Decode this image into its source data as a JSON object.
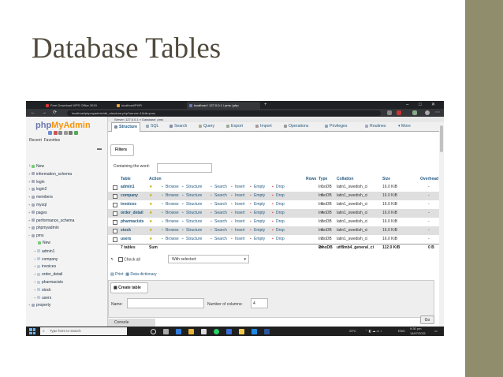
{
  "slide": {
    "title": "Database Tables",
    "accent_bar_color": "#8f8d6b"
  },
  "browser": {
    "tabs": [
      {
        "label": "Free Download WPS Office 2019",
        "favicon": "wps-icon",
        "active": false
      },
      {
        "label": "localhost/PHP/",
        "favicon": "folder-icon",
        "active": false
      },
      {
        "label": "localhost / 127.0.0.1 / pms | php",
        "favicon": "phpmyadmin-icon",
        "active": true
      }
    ],
    "new_tab": "+",
    "url": "localhost/phpmyadmin/db_structure.php?server=1&db=pms",
    "window_controls": [
      "–",
      "□",
      "✕"
    ]
  },
  "pma": {
    "logo_php": "php",
    "logo_myadmin": "MyAdmin",
    "recent": "Recent",
    "favorites": "Favorites",
    "tree": [
      {
        "label": "New",
        "level": 0
      },
      {
        "label": "information_schema",
        "level": 0
      },
      {
        "label": "login",
        "level": 0
      },
      {
        "label": "login2",
        "level": 0
      },
      {
        "label": "members",
        "level": 0
      },
      {
        "label": "mysql",
        "level": 0
      },
      {
        "label": "pages",
        "level": 0
      },
      {
        "label": "performance_schema",
        "level": 0
      },
      {
        "label": "phpmyadmin",
        "level": 0
      },
      {
        "label": "pms",
        "level": 0
      },
      {
        "label": "New",
        "level": 1
      },
      {
        "label": "admin1",
        "level": 1
      },
      {
        "label": "company",
        "level": 1
      },
      {
        "label": "invoices",
        "level": 1
      },
      {
        "label": "order_detail",
        "level": 1
      },
      {
        "label": "pharmacists",
        "level": 1
      },
      {
        "label": "stock",
        "level": 1
      },
      {
        "label": "users",
        "level": 1
      },
      {
        "label": "property",
        "level": 0
      }
    ],
    "breadcrumb": "Server: 127.0.0.1 » Database: pms",
    "nav_tabs": [
      {
        "label": "Structure",
        "active": true,
        "icon": "structure-icon"
      },
      {
        "label": "SQL",
        "active": false,
        "icon": "sql-icon"
      },
      {
        "label": "Search",
        "active": false,
        "icon": "search-icon"
      },
      {
        "label": "Query",
        "active": false,
        "icon": "query-icon"
      },
      {
        "label": "Export",
        "active": false,
        "icon": "export-icon"
      },
      {
        "label": "Import",
        "active": false,
        "icon": "import-icon"
      },
      {
        "label": "Operations",
        "active": false,
        "icon": "wrench-icon"
      },
      {
        "label": "Privileges",
        "active": false,
        "icon": "privileges-icon"
      },
      {
        "label": "Routines",
        "active": false,
        "icon": "routines-icon"
      },
      {
        "label": "More",
        "active": false,
        "icon": "chevron-down-icon"
      }
    ],
    "filters": {
      "legend": "Filters",
      "label": "Containing the word:",
      "value": ""
    },
    "table_headers": {
      "table": "Table",
      "action": "Action",
      "rows": "Rows",
      "type": "Type",
      "collation": "Collation",
      "size": "Size",
      "overhead": "Overhead"
    },
    "actions": [
      "Browse",
      "Structure",
      "Search",
      "Insert",
      "Empty",
      "Drop"
    ],
    "tables": [
      {
        "name": "admin1",
        "rows": "1",
        "type": "InnoDB",
        "collation": "latin1_swedish_ci",
        "size": "16.0 KiB",
        "overhead": "-"
      },
      {
        "name": "company",
        "rows": "6",
        "type": "InnoDB",
        "collation": "latin1_swedish_ci",
        "size": "16.0 KiB",
        "overhead": "-"
      },
      {
        "name": "invoices",
        "rows": "5",
        "type": "InnoDB",
        "collation": "latin1_swedish_ci",
        "size": "16.0 KiB",
        "overhead": "-"
      },
      {
        "name": "order_detail",
        "rows": "4",
        "type": "InnoDB",
        "collation": "latin1_swedish_ci",
        "size": "16.0 KiB",
        "overhead": "-"
      },
      {
        "name": "pharmacists",
        "rows": "2",
        "type": "InnoDB",
        "collation": "latin1_swedish_ci",
        "size": "16.0 KiB",
        "overhead": "-"
      },
      {
        "name": "stock",
        "rows": "6",
        "type": "InnoDB",
        "collation": "latin1_swedish_ci",
        "size": "16.0 KiB",
        "overhead": "-"
      },
      {
        "name": "users",
        "rows": "2",
        "type": "InnoDB",
        "collation": "latin1_swedish_ci",
        "size": "16.0 KiB",
        "overhead": "-"
      }
    ],
    "summary": {
      "tables": "7 tables",
      "sum": "Sum",
      "rows": "24",
      "type": "InnoDB",
      "collation": "utf8mb4_general_ci",
      "size": "112.0 KiB",
      "overhead": "0 B"
    },
    "check_all": "Check all",
    "with_selected": "With selected:",
    "print": "Print",
    "data_dictionary": "Data dictionary",
    "create_table": {
      "legend": "Create table",
      "name_label": "Name:",
      "name_value": "",
      "columns_label": "Number of columns:",
      "columns_value": "4",
      "go": "Go"
    },
    "console": "Console"
  },
  "taskbar": {
    "search_placeholder": "Type here to search",
    "weather": "29°C",
    "lang": "ENG",
    "time": "9:30 pm",
    "date": "14/07/2021"
  }
}
